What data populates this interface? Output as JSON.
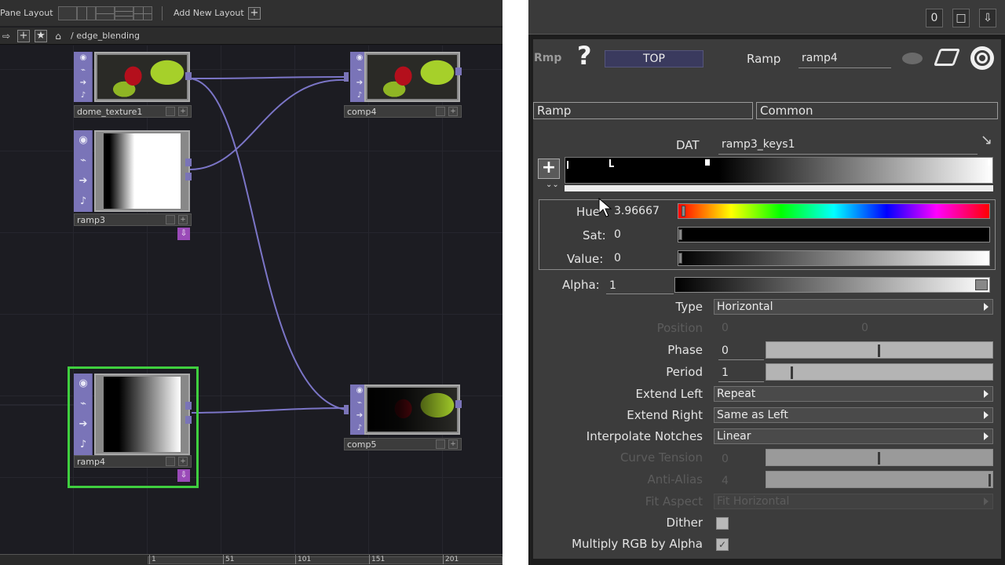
{
  "network": {
    "toolbar": {
      "pane_layout_label": "Pane Layout",
      "add_new_layout_label": "Add New Layout",
      "add_plus": "+"
    },
    "pathbar": {
      "path": "/ edge_blending",
      "plus": "+",
      "star": "★"
    },
    "nodes": [
      {
        "id": "dome_texture1",
        "name": "dome_texture1"
      },
      {
        "id": "ramp3",
        "name": "ramp3"
      },
      {
        "id": "ramp4",
        "name": "ramp4"
      },
      {
        "id": "comp4",
        "name": "comp4"
      },
      {
        "id": "comp5",
        "name": "comp5"
      }
    ],
    "timeline": {
      "ticks": [
        "1",
        "51",
        "101",
        "151",
        "201"
      ]
    }
  },
  "panel_header": {
    "op_short": "Rmp",
    "help_glyph": "?",
    "family": "TOP",
    "type_label": "Ramp",
    "op_name": "ramp4",
    "window_buttons": [
      "0",
      "□",
      "⇩"
    ]
  },
  "tabs": [
    "Ramp",
    "Common"
  ],
  "params": {
    "dat_label": "DAT",
    "dat_value": "ramp3_keys1",
    "hue_label": "Hue",
    "hue_value": "3.96667",
    "hue_level": 0.011,
    "sat_label": "Sat:",
    "sat_value": "0",
    "value_label": "Value:",
    "value_value": "0",
    "alpha_label": "Alpha:",
    "alpha_value": "1",
    "type_label": "Type",
    "type_value": "Horizontal",
    "position_label": "Position",
    "position_x": "0",
    "position_y": "0",
    "phase_label": "Phase",
    "phase_value": "0",
    "phase_level": 0.5,
    "period_label": "Period",
    "period_value": "1",
    "period_level": 0.11,
    "extend_left_label": "Extend Left",
    "extend_left_value": "Repeat",
    "extend_right_label": "Extend Right",
    "extend_right_value": "Same as Left",
    "interpolate_label": "Interpolate Notches",
    "interpolate_value": "Linear",
    "curve_tension_label": "Curve Tension",
    "curve_tension_value": "0",
    "curve_tension_level": 0.5,
    "anti_alias_label": "Anti-Alias",
    "anti_alias_value": "4",
    "anti_alias_level": 1.0,
    "fit_aspect_label": "Fit Aspect",
    "fit_aspect_value": "Fit Horizontal",
    "dither_label": "Dither",
    "dither_checked": false,
    "multiply_label": "Multiply RGB by Alpha",
    "multiply_checked": true
  },
  "colors": {
    "node_strip": "#7a74b8",
    "wire": "#7b75c7",
    "selected_outline": "#3fcf3f",
    "panel_bg": "#3c3c3c",
    "family_badge": "#3a3a5e"
  }
}
